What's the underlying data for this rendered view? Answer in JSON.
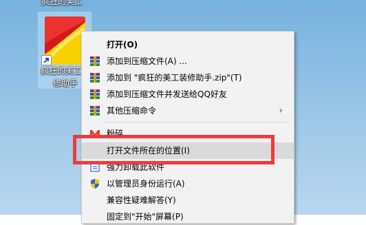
{
  "desktop": {
    "top_label": "疯狂的美工",
    "icon_label": "疯狂的美工装修助手"
  },
  "menu": {
    "items": [
      {
        "label": "打开(O)",
        "icon": "none"
      },
      {
        "label": "添加到压缩文件(A) ...",
        "icon": "winrar-icon"
      },
      {
        "label": "添加到 \"疯狂的美工装修助手.zip\"(T)",
        "icon": "winrar-icon"
      },
      {
        "label": "添加到压缩文件并发送给QQ好友",
        "icon": "winrar-icon"
      },
      {
        "label": "其他压缩命令",
        "icon": "winrar-icon"
      },
      {
        "label": "粉碎",
        "icon": "shred-icon"
      },
      {
        "label": "打开文件所在的位置(I)",
        "icon": "none"
      },
      {
        "label": "强力卸载此软件",
        "icon": "uninstall-icon"
      },
      {
        "label": "以管理员身份运行(A)",
        "icon": "uac-shield-icon"
      },
      {
        "label": "兼容性疑难解答(Y)",
        "icon": "none"
      },
      {
        "label": "固定到\"开始\"屏幕(P)",
        "icon": "none"
      }
    ],
    "submenu_arrow": "›"
  },
  "colors": {
    "highlight_box": "#ee3b3b",
    "menu_background": "#f2f2f2"
  }
}
